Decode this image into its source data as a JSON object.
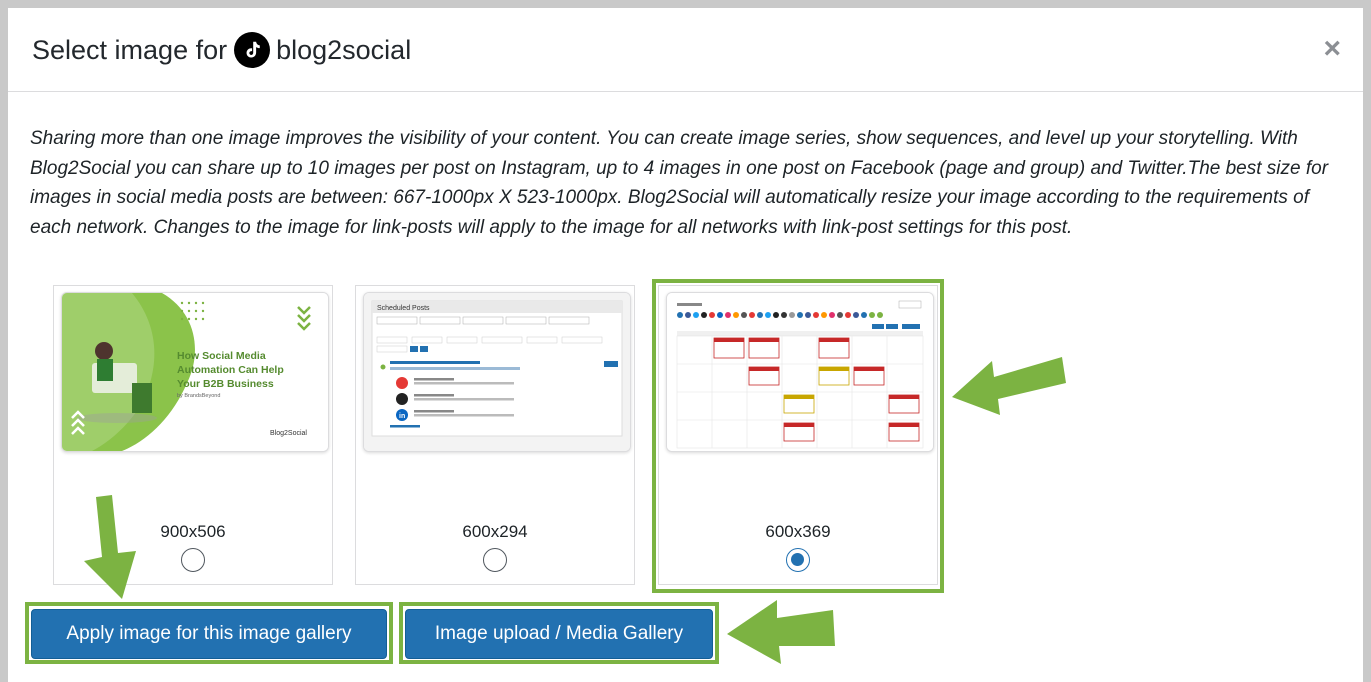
{
  "dialog": {
    "title_prefix": "Select image for",
    "title_account": "blog2social",
    "close_label": "×",
    "description": "Sharing more than one image improves the visibility of your content. You can create image series, show sequences, and level up your storytelling. With Blog2Social you can share up to 10 images per post on Instagram, up to 4 images in one post on Facebook (page and group) and Twitter.The best size for images in social media posts are between: 667-1000px X 523-1000px. Blog2Social will automatically resize your image according to the requirements of each network. Changes to the image for link-posts will apply to the image for all networks with link-post settings for this post."
  },
  "images": [
    {
      "size": "900x506",
      "selected": false,
      "thumb_title": "How Social Media Automation Can Help Your B2B Business",
      "thumb_author": "by BrandsBeyond",
      "thumb_logo": "Blog2Social"
    },
    {
      "size": "600x294",
      "selected": false,
      "thumb_title": "Scheduled Posts"
    },
    {
      "size": "600x369",
      "selected": true
    }
  ],
  "buttons": {
    "apply_label": "Apply image for this image gallery",
    "upload_label": "Image upload / Media Gallery"
  },
  "colors": {
    "primary": "#2271b1",
    "highlight": "#7cb342",
    "overlay": "#c9c9c9"
  },
  "icons": {
    "account": "tiktok-icon",
    "close": "close-icon"
  }
}
